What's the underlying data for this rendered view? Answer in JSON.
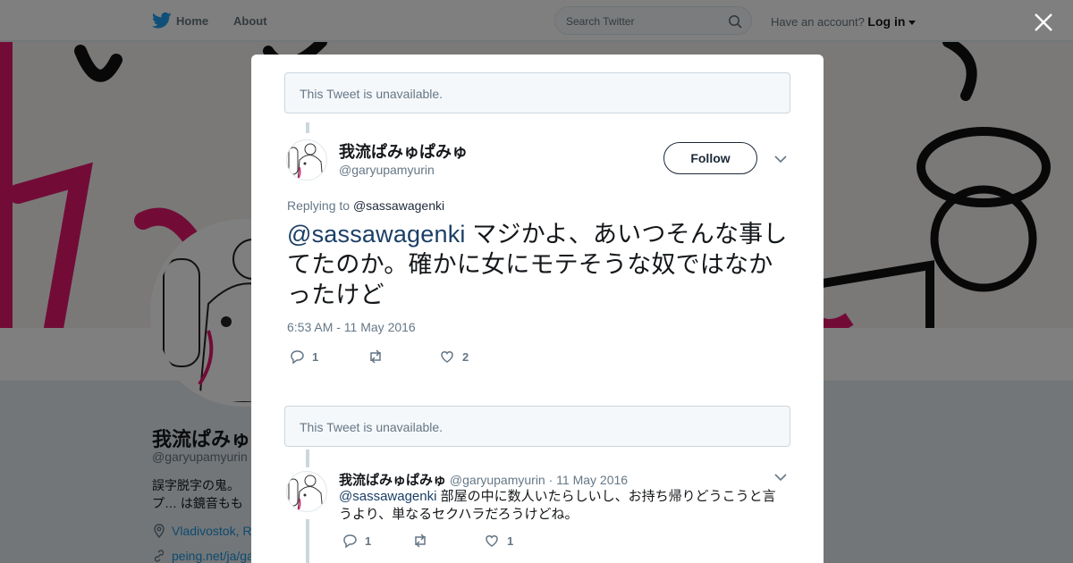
{
  "topbar": {
    "home_label": "Home",
    "about_label": "About",
    "search_placeholder": "Search Twitter",
    "account_prompt": "Have an account?",
    "login_label": "Log in"
  },
  "profile": {
    "display_name": "我流ぱみゅぱみゅ",
    "handle": "@garyupamyurin",
    "bio": "誤字脱字の鬼。プ… は鏡音ももこさん…",
    "location": "Vladivostok, R…",
    "link": "peing.net/ja/ga…"
  },
  "modal": {
    "unavailable_text_1": "This Tweet is unavailable.",
    "main_tweet": {
      "display_name": "我流ぱみゅぱみゅ",
      "handle": "@garyupamyurin",
      "follow_label": "Follow",
      "replying_prefix": "Replying to",
      "replying_to": "@sassawagenki",
      "mention": "@sassawagenki",
      "text": " マジかよ、あいつそんな事してたのか。確かに女にモテそうな奴ではなかったけど",
      "timestamp": "6:53 AM - 11 May 2016",
      "reply_count": "1",
      "retweet_count": "",
      "like_count": "2"
    },
    "unavailable_text_2": "This Tweet is unavailable.",
    "reply_tweet": {
      "display_name": "我流ぱみゅぱみゅ",
      "handle": "@garyupamyurin",
      "separator": "·",
      "date": "11 May 2016",
      "mention": "@sassawagenki",
      "text": " 部屋の中に数人いたらしいし、お持ち帰りどうこうと言うより、単なるセクハラだろうけどね。",
      "reply_count": "1",
      "retweet_count": "",
      "like_count": "1"
    }
  },
  "colors": {
    "overlay": "rgba(0,0,0,0.5)",
    "mention_blue": "#1b3f66",
    "follow_border": "#1c2938",
    "banner_pink": "#e5196f"
  },
  "icons": [
    "twitter-bird-icon",
    "search-icon",
    "caret-down-icon",
    "close-icon",
    "chevron-down-icon",
    "reply-icon",
    "retweet-icon",
    "heart-icon",
    "location-pin-icon",
    "link-icon"
  ]
}
